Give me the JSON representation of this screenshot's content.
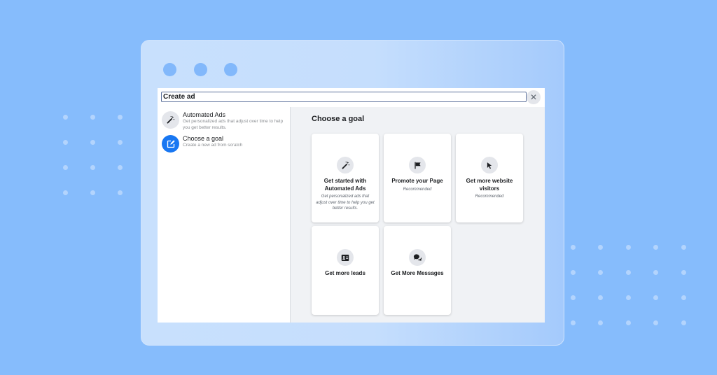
{
  "dialog": {
    "title": "Create ad",
    "close_icon": "close-icon"
  },
  "sidebar": {
    "items": [
      {
        "title": "Automated Ads",
        "subtitle": "Get personalized ads that adjust over time to help you get better results.",
        "icon": "magic-wand-icon"
      },
      {
        "title": "Choose a goal",
        "subtitle": "Create a new ad from scratch",
        "icon": "edit-icon"
      }
    ]
  },
  "main": {
    "title": "Choose a goal",
    "cards": [
      {
        "title": "Get started with Automated Ads",
        "subtitle": "Get personalized ads that adjust over time to help you get better results.",
        "icon": "magic-wand-icon"
      },
      {
        "title": "Promote your Page",
        "subtitle": "Recommended",
        "icon": "flag-icon"
      },
      {
        "title": "Get more website visitors",
        "subtitle": "Recommended",
        "icon": "cursor-icon"
      },
      {
        "title": "Get more leads",
        "subtitle": "",
        "icon": "contact-card-icon"
      },
      {
        "title": "Get More Messages",
        "subtitle": "",
        "icon": "chat-bubbles-icon"
      }
    ]
  },
  "colors": {
    "background": "#86bcfc",
    "accent": "#1877f2",
    "icon_bg": "#e4e6eb"
  }
}
